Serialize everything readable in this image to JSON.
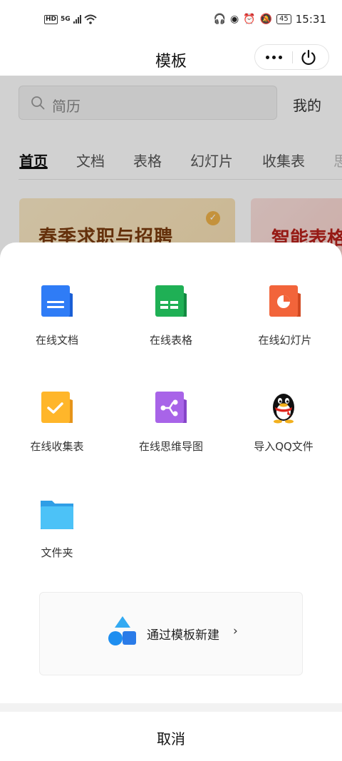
{
  "status_bar": {
    "hd_label": "HD",
    "network_label": "5G",
    "battery": "45",
    "time": "15:31",
    "icons": [
      "signal-icon",
      "wifi-icon",
      "headphones-icon",
      "eye-icon",
      "alarm-icon",
      "mute-icon",
      "battery-icon"
    ]
  },
  "header": {
    "title": "模板",
    "more_icon": "more-icon",
    "power_icon": "power-icon"
  },
  "background_page": {
    "search_placeholder": "简历",
    "mine_label": "我的",
    "tabs": [
      {
        "label": "首页",
        "active": true
      },
      {
        "label": "文档"
      },
      {
        "label": "表格"
      },
      {
        "label": "幻灯片"
      },
      {
        "label": "收集表"
      },
      {
        "label": "思"
      }
    ],
    "banners": [
      {
        "title": "春季求职与招聘"
      },
      {
        "title": "智能表格"
      }
    ]
  },
  "sheet": {
    "items": [
      {
        "label": "在线文档",
        "icon": "doc-icon",
        "color": "#2f7cf6"
      },
      {
        "label": "在线表格",
        "icon": "sheet-icon",
        "color": "#1fb055"
      },
      {
        "label": "在线幻灯片",
        "icon": "slides-icon",
        "color": "#f2643a"
      },
      {
        "label": "在线收集表",
        "icon": "form-icon",
        "color": "#ffb62a"
      },
      {
        "label": "在线思维导图",
        "icon": "mindmap-icon",
        "color": "#a864e8"
      },
      {
        "label": "导入QQ文件",
        "icon": "qq-icon",
        "color": "#111111"
      },
      {
        "label": "文件夹",
        "icon": "folder-icon",
        "color": "#3bb4f2"
      }
    ],
    "template_link": {
      "label": "通过模板新建",
      "chevron": "›"
    },
    "cancel_label": "取消"
  }
}
